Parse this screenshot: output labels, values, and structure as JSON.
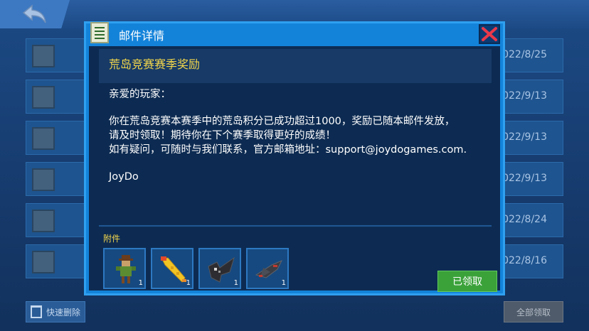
{
  "background_list": {
    "rows": [
      {
        "date": "2022/8/25"
      },
      {
        "date": "2022/9/13"
      },
      {
        "date": "2022/9/13"
      },
      {
        "date": "2022/9/13"
      },
      {
        "date": "2022/8/24"
      },
      {
        "date": "2022/8/16"
      }
    ],
    "quick_delete_label": "快速删除",
    "claim_all_label": "全部领取"
  },
  "dialog": {
    "title": "邮件详情",
    "subject": "荒岛竞赛赛季奖励",
    "body": {
      "greeting": "亲爱的玩家：",
      "line1": "你在荒岛竞赛本赛季中的荒岛积分已成功超过1000，奖励已随本邮件发放，",
      "line2": "请及时领取！期待你在下个赛季取得更好的成绩！",
      "line3": "如有疑问，可随时与我们联系，官方邮箱地址：support@joydogames.com.",
      "signature": "JoyDo"
    },
    "attachments_label": "附件",
    "attachments": [
      {
        "icon": "scarecrow-skin-icon",
        "count": "1"
      },
      {
        "icon": "rubber-chicken-weapon-icon",
        "count": "1"
      },
      {
        "icon": "dark-wing-icon",
        "count": "1"
      },
      {
        "icon": "jet-plane-icon",
        "count": "1"
      }
    ],
    "claimed_label": "已领取"
  },
  "colors": {
    "dialog_border": "#2fa0f0",
    "subject": "#f3d64b",
    "claimed_button": "#3ba23a",
    "close_x": "#e8394a"
  }
}
